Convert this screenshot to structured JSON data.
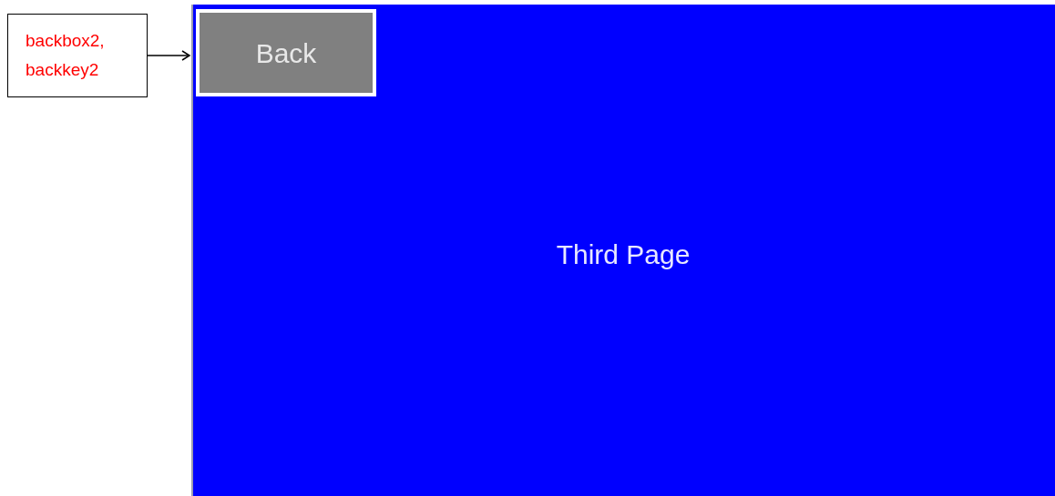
{
  "annotation": {
    "lines": [
      "backbox2,",
      "backkey2"
    ]
  },
  "screen": {
    "back_button": {
      "label": "Back"
    },
    "page_title": "Third Page"
  }
}
